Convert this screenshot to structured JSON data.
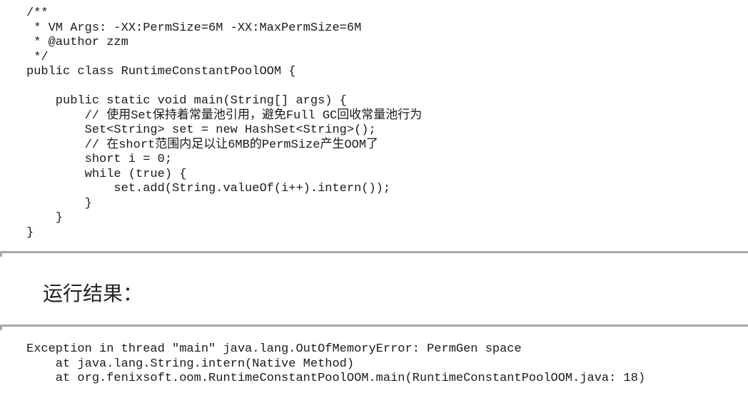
{
  "code_top": {
    "lines": [
      "/**",
      " * VM Args: -XX:PermSize=6M -XX:MaxPermSize=6M",
      " * @author zzm",
      " */",
      "public class RuntimeConstantPoolOOM {",
      "",
      "    public static void main(String[] args) {",
      "        // 使用Set保持着常量池引用，避免Full GC回收常量池行为",
      "        Set<String> set = new HashSet<String>();",
      "        // 在short范围内足以让6MB的PermSize产生OOM了",
      "        short i = 0;",
      "        while (true) {",
      "            set.add(String.valueOf(i++).intern());",
      "        }",
      "    }",
      "}"
    ]
  },
  "result_heading": "运行结果：",
  "code_bottom": {
    "lines": [
      "Exception in thread \"main\" java.lang.OutOfMemoryError: PermGen space",
      "    at java.lang.String.intern(Native Method)",
      "    at org.fenixsoft.oom.RuntimeConstantPoolOOM.main(RuntimeConstantPoolOOM.java: 18)"
    ]
  },
  "colors": {
    "text": "#1a1a1a",
    "divider": "#a9a9a9",
    "background": "#ffffff"
  }
}
